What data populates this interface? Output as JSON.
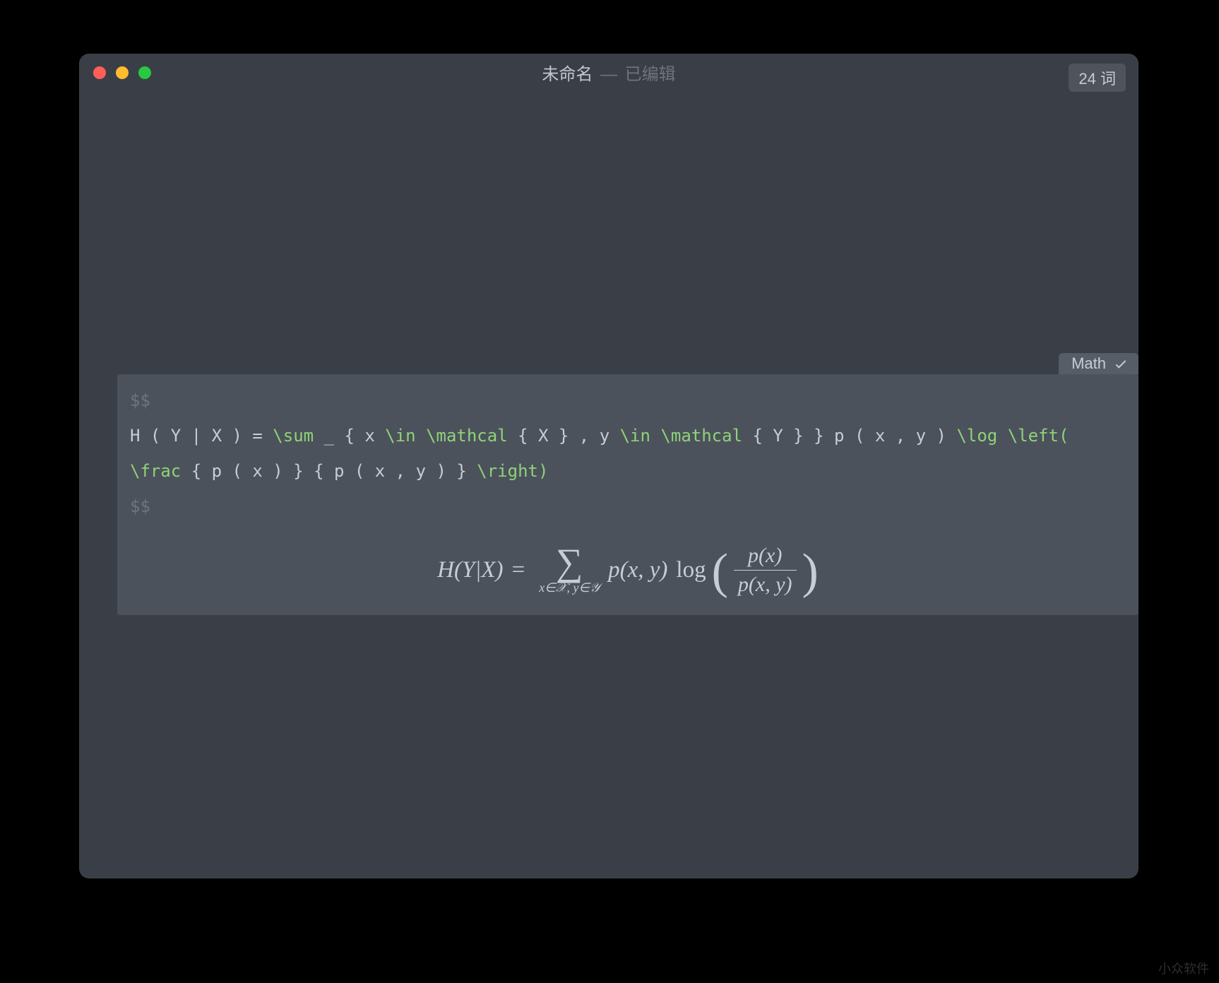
{
  "titlebar": {
    "name": "未命名",
    "separator": "—",
    "edited": "已编辑"
  },
  "wordcount": "24 词",
  "math_block": {
    "tab_label": "Math",
    "delim_open": "$$",
    "delim_close": "$$",
    "tokens": {
      "p1": "H ( Y | X ) = ",
      "c1": "\\sum",
      "p2": " _ { x ",
      "c2": "\\in",
      "p3": " ",
      "c3": "\\mathcal",
      "p4": " { X } , y ",
      "c4": "\\in",
      "p5": " ",
      "c5": "\\mathcal",
      "p6": " { Y } } p ( x , y ) ",
      "c6": "\\log",
      "p7": " ",
      "c7": "\\left(",
      "p8": " ",
      "c8": "\\frac",
      "p9": " { p ( x ) } { p ( x , y ) } ",
      "c9": "\\right)"
    },
    "render": {
      "lhs": "H(Y|X)",
      "eq": "=",
      "sum_sub": "x∈𝒳, y∈𝒴",
      "pxy": "p(x, y)",
      "log_label": "log",
      "frac_num": "p(x)",
      "frac_den": "p(x, y)"
    }
  },
  "watermark": "小众软件"
}
